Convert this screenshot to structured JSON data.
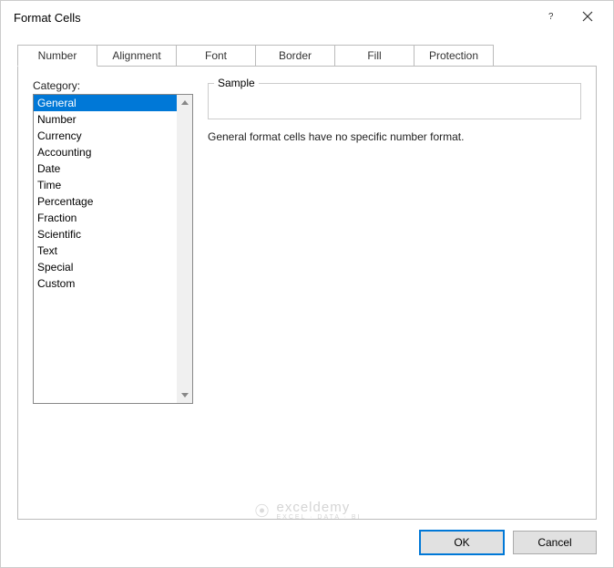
{
  "dialog": {
    "title": "Format Cells"
  },
  "tabs": [
    {
      "label": "Number"
    },
    {
      "label": "Alignment"
    },
    {
      "label": "Font"
    },
    {
      "label": "Border"
    },
    {
      "label": "Fill"
    },
    {
      "label": "Protection"
    }
  ],
  "category": {
    "label": "Category:",
    "items": [
      "General",
      "Number",
      "Currency",
      "Accounting",
      "Date",
      "Time",
      "Percentage",
      "Fraction",
      "Scientific",
      "Text",
      "Special",
      "Custom"
    ]
  },
  "sample": {
    "label": "Sample"
  },
  "description": "General format cells have no specific number format.",
  "buttons": {
    "ok": "OK",
    "cancel": "Cancel"
  },
  "watermark": {
    "main": "exceldemy",
    "sub": "EXCEL · DATA · BI"
  }
}
